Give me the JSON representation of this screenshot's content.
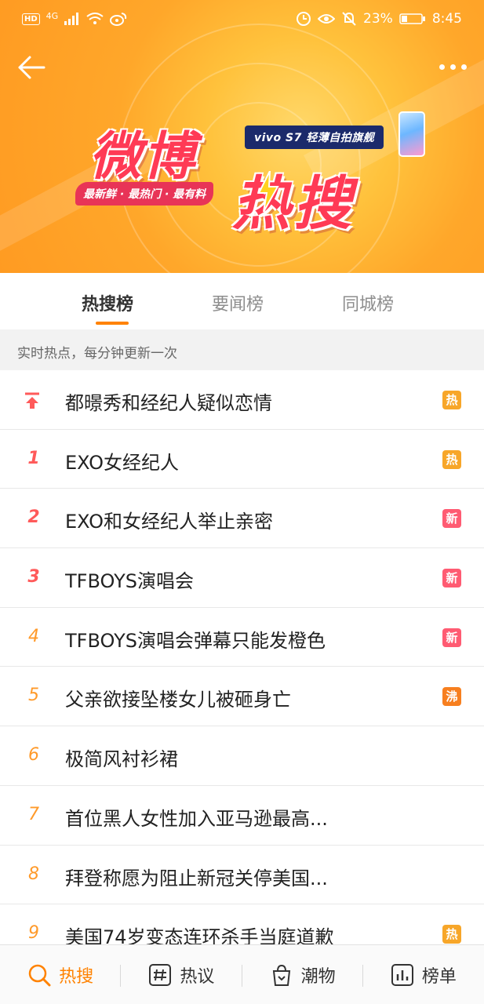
{
  "statusbar": {
    "network": "HD",
    "signal_label": "4G",
    "battery": "23%",
    "time": "8:45"
  },
  "header": {
    "logo_line1": "微博",
    "logo_line2": "热搜",
    "slogan": "最新鲜 · 最热门 · 最有料",
    "sponsor": "vivo S7 轻薄自拍旗舰"
  },
  "tabs": [
    {
      "label": "热搜榜",
      "active": true
    },
    {
      "label": "要闻榜",
      "active": false
    },
    {
      "label": "同城榜",
      "active": false
    }
  ],
  "subhead": "实时热点，每分钟更新一次",
  "items": [
    {
      "rank": "",
      "pinned": true,
      "title": "都暻秀和经纪人疑似恋情",
      "badge": "热",
      "badge_color": "#f7a629"
    },
    {
      "rank": "1",
      "title": "EXO女经纪人",
      "badge": "热",
      "badge_color": "#f7a629"
    },
    {
      "rank": "2",
      "title": "EXO和女经纪人举止亲密",
      "badge": "新",
      "badge_color": "#ff5b72"
    },
    {
      "rank": "3",
      "title": "TFBOYS演唱会",
      "badge": "新",
      "badge_color": "#ff5b72"
    },
    {
      "rank": "4",
      "title": "TFBOYS演唱会弹幕只能发橙色",
      "badge": "新",
      "badge_color": "#ff5b72"
    },
    {
      "rank": "5",
      "title": "父亲欲接坠楼女儿被砸身亡",
      "badge": "沸",
      "badge_color": "#f77f1f"
    },
    {
      "rank": "6",
      "title": "极简风衬衫裙",
      "badge": "",
      "badge_color": ""
    },
    {
      "rank": "7",
      "title": "首位黑人女性加入亚马逊最高...",
      "badge": "",
      "badge_color": ""
    },
    {
      "rank": "8",
      "title": "拜登称愿为阻止新冠关停美国...",
      "badge": "",
      "badge_color": ""
    },
    {
      "rank": "9",
      "title": "美国74岁变态连环杀手当庭道歉",
      "badge": "热",
      "badge_color": "#f7a629"
    }
  ],
  "bottom_nav": [
    {
      "label": "热搜",
      "icon": "search-icon",
      "active": true
    },
    {
      "label": "热议",
      "icon": "hashtag-icon",
      "active": false
    },
    {
      "label": "潮物",
      "icon": "shopping-bag-icon",
      "active": false
    },
    {
      "label": "榜单",
      "icon": "bar-chart-icon",
      "active": false
    }
  ],
  "colors": {
    "accent": "#ff8200",
    "banner": "#ffa72a",
    "top3_rank": "#ff5a5a",
    "other_rank": "#ff9a2a"
  }
}
